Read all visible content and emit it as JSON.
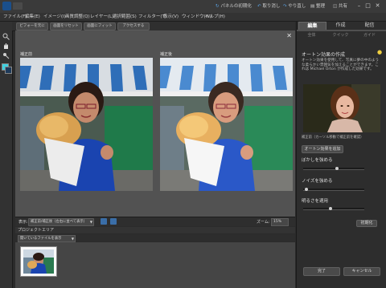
{
  "titlebar": {
    "buttons": [
      {
        "label": "パネルの初期化"
      },
      {
        "label": "取り消し"
      },
      {
        "label": "やり直し"
      },
      {
        "label": "整理"
      },
      {
        "label": "共有"
      }
    ]
  },
  "menubar": {
    "items": [
      "ファイル(F)",
      "編集(E)",
      "イメージ(I)",
      "画質調整(Q)",
      "レイヤー(L)",
      "選択範囲(S)",
      "フィルター(T)",
      "表示(V)",
      "ウィンドウ(W)",
      "ヘルプ(H)"
    ]
  },
  "optionsbar": {
    "buttons": [
      "ビフォーを元に",
      "画面をリセット",
      "画面にフィット",
      "アクセスする"
    ]
  },
  "workspace": {
    "before_label": "補正前",
    "after_label": "補正後"
  },
  "viewbar": {
    "view_label": "表示:",
    "view_value": "補正前/補正後（左右に並べて表示）",
    "zoom_label": "ズーム:",
    "zoom_value": "15%"
  },
  "bin": {
    "header": "プロジェクトエリア",
    "selector": "開いているファイルを表示"
  },
  "rpanel": {
    "tabs": [
      "編集",
      "作成",
      "配信"
    ],
    "subtabs": [
      "全体",
      "クイック",
      "ガイド"
    ],
    "section_title": "オートン効果の作成",
    "description": "オートン効果を使用して、写真に夢の中のような柔らかい雰囲気を加えることができます。これは Michael Orton が作成した効果です。",
    "caption": "補正前（カーソル移動で補正前を確認）",
    "apply_button": "オートン効果を追加",
    "sliders": [
      {
        "label": "ぼかしを強める",
        "value": 0.55
      },
      {
        "label": "ノイズを強める",
        "value": 0.05
      },
      {
        "label": "明るさを適用",
        "value": 0.45
      }
    ],
    "reset_button": "初期化",
    "ok_button": "完了",
    "cancel_button": "キャンセル"
  },
  "colors": {
    "accent": "#4a90d9",
    "panel_bg": "#2d2d2d",
    "canvas_bg": "#525252"
  }
}
